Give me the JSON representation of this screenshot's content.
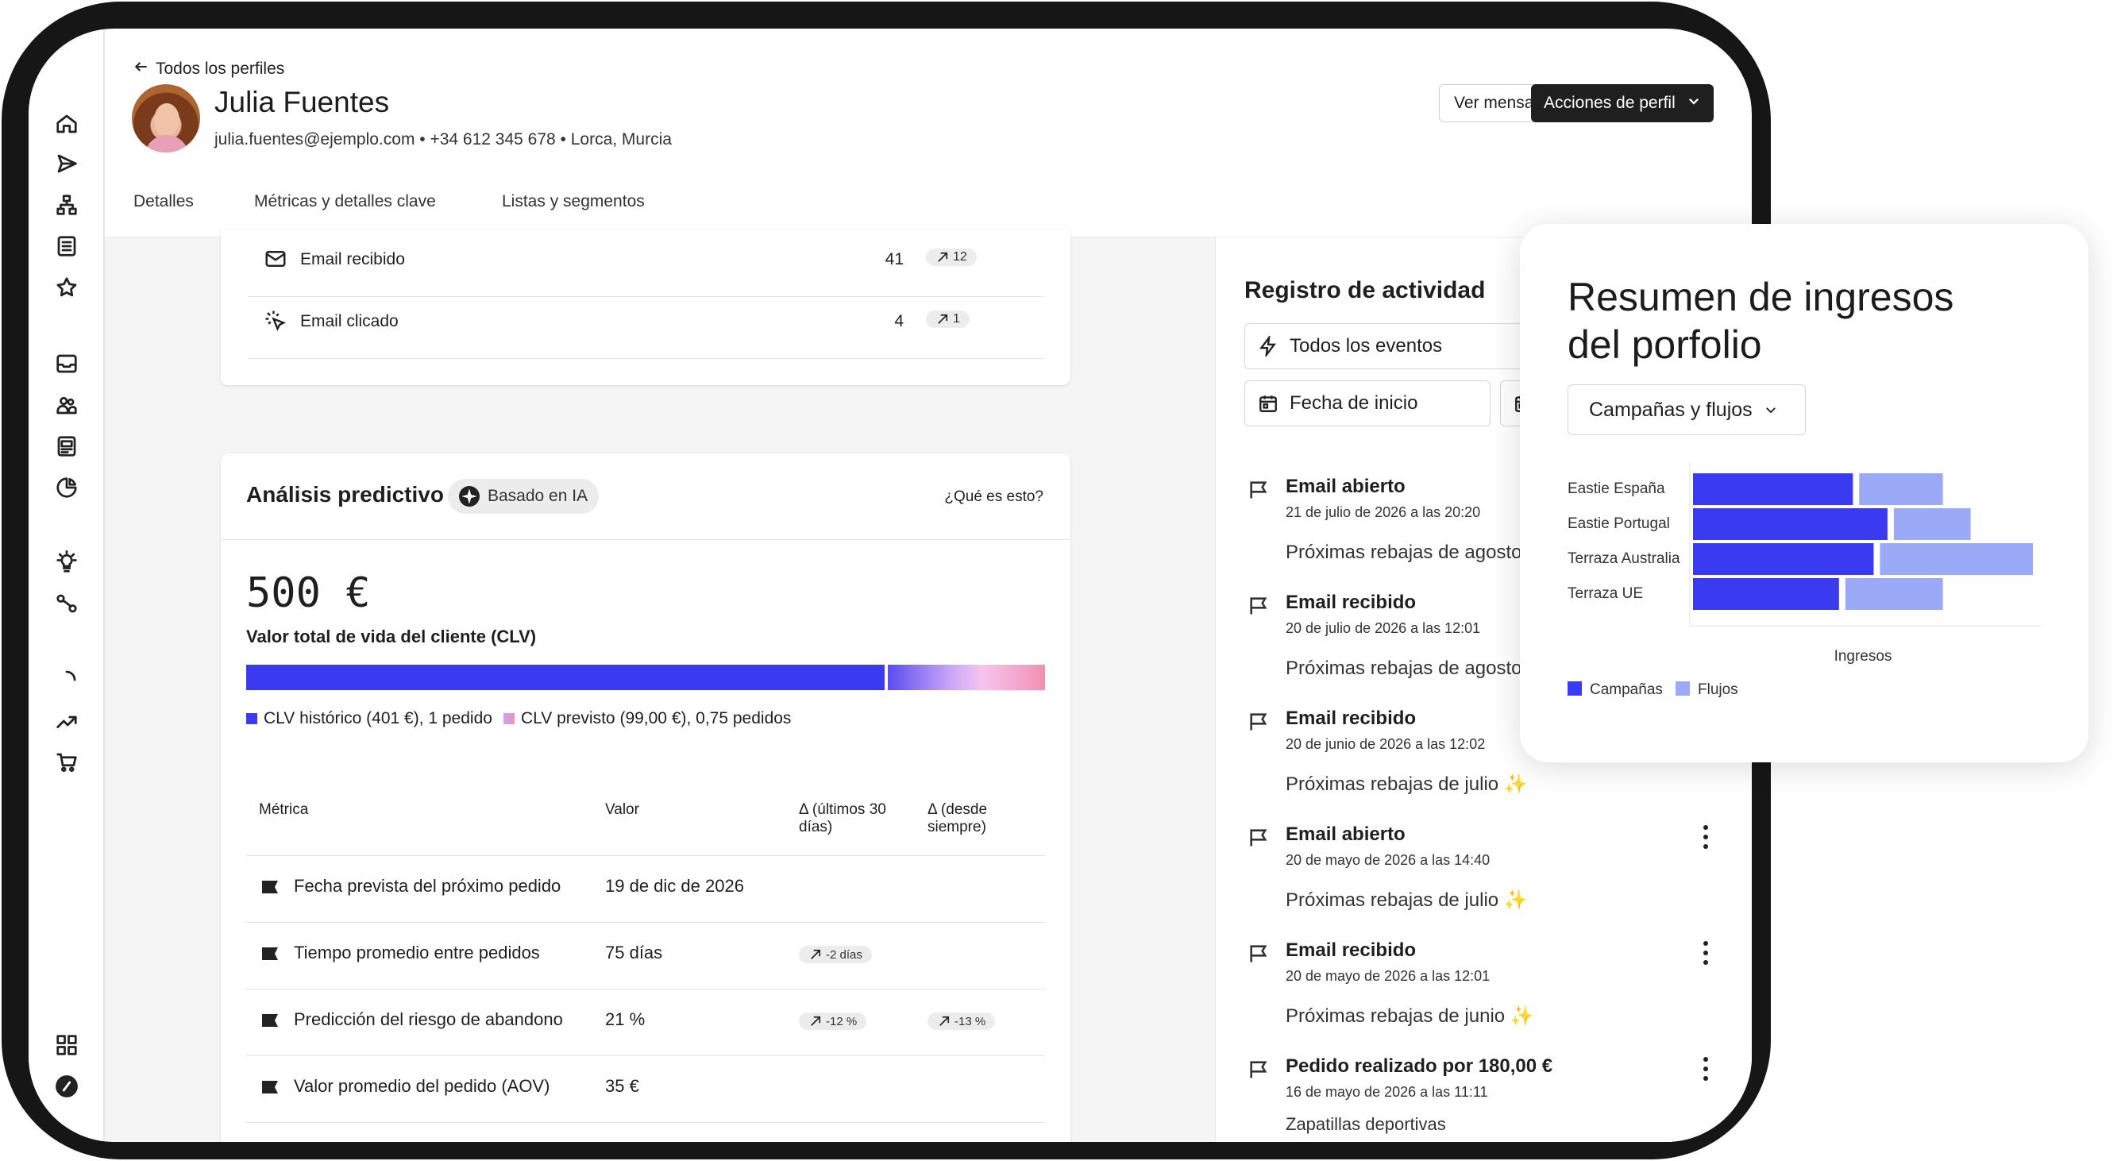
{
  "header": {
    "back_label": "Todos los perfiles",
    "name": "Julia Fuentes",
    "meta": "julia.fuentes@ejemplo.com • +34 612 345 678 • Lorca, Murcia",
    "btn_messages": "Ver mensajes",
    "btn_actions": "Acciones de perfil"
  },
  "tabs": [
    "Detalles",
    "Métricas y detalles clave",
    "Listas y segmentos"
  ],
  "events_summary": [
    {
      "label": "Email recibido",
      "count": "41",
      "trend": "12",
      "icon": "mail-icon"
    },
    {
      "label": "Email clicado",
      "count": "4",
      "trend": "1",
      "icon": "cursor-click-icon"
    }
  ],
  "predictive": {
    "title": "Análisis predictivo",
    "ai_badge": "Basado en IA",
    "help": "¿Qué es esto?",
    "clv_value": "500 €",
    "clv_label": "Valor total de vida del cliente (CLV)",
    "clv_historic_fraction": 0.802,
    "legend_historic": "CLV histórico (401 €), 1 pedido",
    "legend_predicted": "CLV previsto (99,00 €), 0,75 pedidos",
    "table_headers": [
      "Métrica",
      "Valor",
      "Δ (últimos 30 días)",
      "Δ (desde siempre)"
    ],
    "rows": [
      {
        "metric": "Fecha prevista del próximo pedido",
        "value": "19 de dic de 2026",
        "d30": "",
        "dall": ""
      },
      {
        "metric": "Tiempo promedio entre pedidos",
        "value": "75 días",
        "d30": "-2 días",
        "dall": ""
      },
      {
        "metric": "Predicción del riesgo de abandono",
        "value": "21 %",
        "d30": "-12 %",
        "dall": "-13 %"
      },
      {
        "metric": "Valor promedio del pedido (AOV)",
        "value": "35 €",
        "d30": "",
        "dall": ""
      }
    ]
  },
  "activity": {
    "title": "Registro de actividad",
    "filter_events": "Todos los eventos",
    "filter_date": "Fecha de inicio",
    "items": [
      {
        "title": "Email abierto",
        "date": "21 de julio de 2026 a las 20:20",
        "sub": "Próximas rebajas de agosto ✨"
      },
      {
        "title": "Email recibido",
        "date": "20 de julio de 2026 a las 12:01",
        "sub": "Próximas rebajas de agosto ✨"
      },
      {
        "title": "Email recibido",
        "date": "20 de junio de 2026 a las 12:02",
        "sub": "Próximas rebajas de julio ✨"
      },
      {
        "title": "Email abierto",
        "date": "20 de mayo de 2026 a las 14:40",
        "sub": "Próximas rebajas de julio ✨"
      },
      {
        "title": "Email recibido",
        "date": "20 de mayo de 2026 a las 12:01",
        "sub": "Próximas rebajas de junio ✨"
      },
      {
        "title": "Pedido realizado por 180,00 €",
        "date": "16 de mayo de 2026 a las 11:11",
        "sub": "Zapatillas deportivas"
      }
    ]
  },
  "revenue_card": {
    "title_line1": "Resumen de ingresos",
    "title_line2": "del porfolio",
    "dropdown": "Campañas y flujos",
    "chart_data": {
      "type": "bar",
      "orientation": "horizontal",
      "stacked": true,
      "categories": [
        "Eastie España",
        "Eastie Portugal",
        "Terraza Australia",
        "Terraza UE"
      ],
      "series": [
        {
          "name": "Campañas",
          "values": [
            48,
            58,
            54,
            44
          ],
          "color": "#3a3af0"
        },
        {
          "name": "Flujos",
          "values": [
            26,
            24,
            46,
            30
          ],
          "color": "#9aaaf7"
        }
      ],
      "xlabel": "Ingresos",
      "xlim": [
        0,
        100
      ],
      "legend": "bottom-left"
    }
  }
}
